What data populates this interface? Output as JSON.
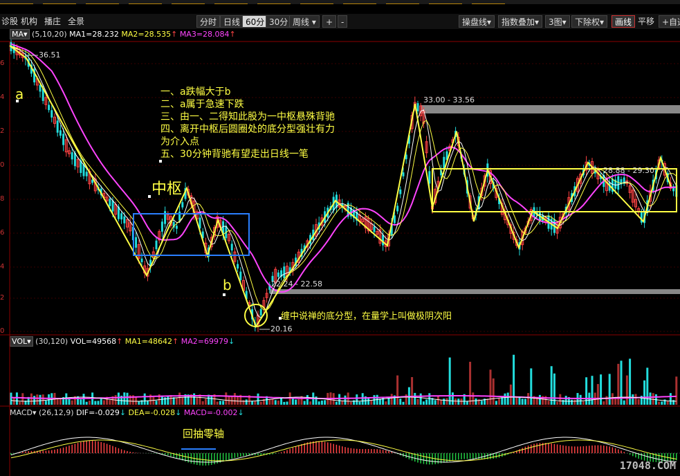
{
  "toolbar_left": [
    "诊股",
    "机构",
    "播庄",
    "全景"
  ],
  "periods": [
    "分时",
    "日线",
    "60分",
    "30分",
    "周线"
  ],
  "active_period": "60分",
  "add_btn": "+",
  "minus_btn": "-",
  "toolbar_right": [
    "操盘线",
    "指数叠加",
    "3图",
    "下除权",
    "画线",
    "平移",
    "+自选"
  ],
  "ma_legend": {
    "tag": "MA",
    "params": "(5,10,20)",
    "ma1": "MA1=28.232",
    "ma2": "MA2=28.535",
    "ma3": "MA3=28.084"
  },
  "vol_legend": {
    "tag": "VOL",
    "params": "(30,120)",
    "vol": "VOL=49568",
    "ma1": "MA1=48642",
    "ma2": "MA2=69979"
  },
  "macd_legend": {
    "tag": "MACD",
    "params": "(26,12,9)",
    "dif": "DIF=-0.029",
    "dea": "DEA=-0.028",
    "macd": "MACD=-0.002"
  },
  "annotations": {
    "price_high": "36.51",
    "label_a": "a",
    "label_b": "b",
    "center_label": "中枢",
    "notes": [
      "一、a跌幅大于b",
      "二、a属于急速下跌",
      "三、由一、二得知此股为一中枢悬殊背驰",
      "四、离开中枢后圆圈处的底分型强壮有力",
      "为介入点",
      "五、30分钟背驰有望走出日线一笔"
    ],
    "zone_top": "33.00 - 33.56",
    "zone_mid": "28.88 - 29.30",
    "zone_low": "22.24 - 22.58",
    "price_low": "20.16",
    "bottom_note": "缠中说禅的底分型，在量学上叫做极阴次阳",
    "pullback": "回抽零轴"
  },
  "y_ticks": [
    "6",
    "4",
    "2",
    "0",
    "8",
    "6",
    "4",
    "2",
    "0"
  ],
  "watermark": "17048.COM",
  "colors": {
    "ma3": "#ff44ff",
    "yellow": "#ffff44",
    "blue": "#2a7fff",
    "up": "#ff4444",
    "down": "#22dddd"
  }
}
